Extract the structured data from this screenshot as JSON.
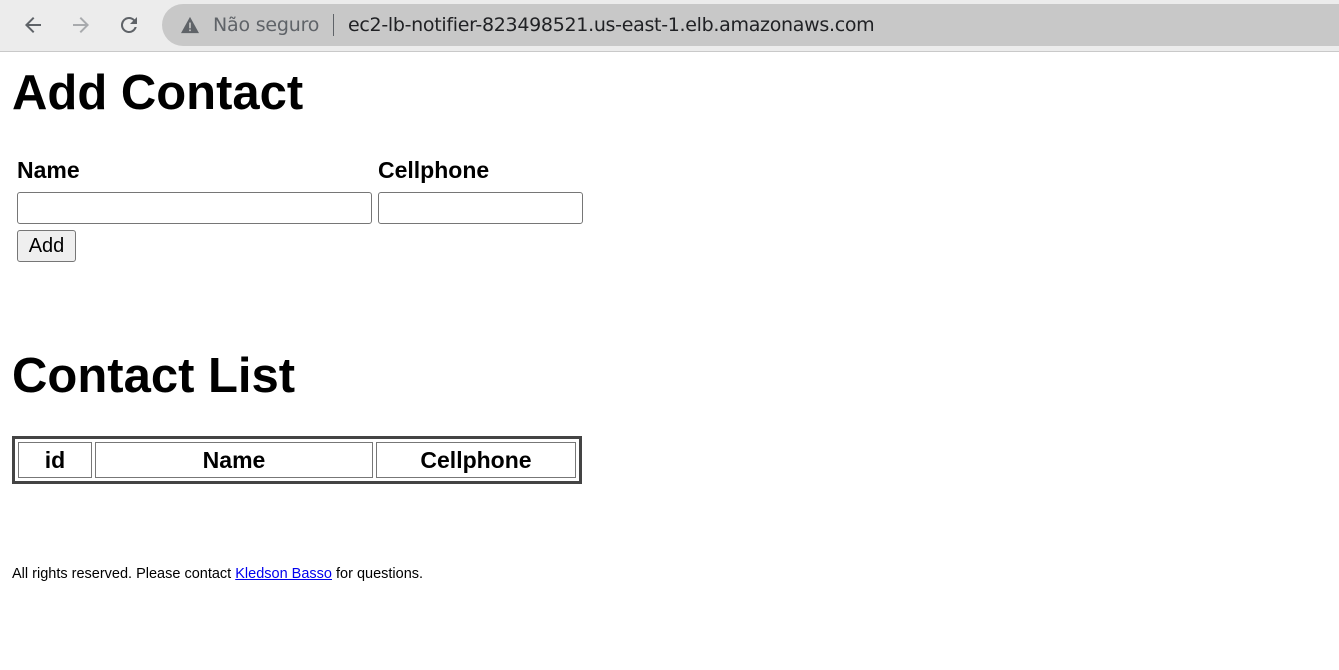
{
  "browser": {
    "security_label": "Não seguro",
    "url": "ec2-lb-notifier-823498521.us-east-1.elb.amazonaws.com"
  },
  "form": {
    "title": "Add Contact",
    "name_label": "Name",
    "name_value": "",
    "cellphone_label": "Cellphone",
    "cellphone_value": "",
    "add_button": "Add"
  },
  "list": {
    "title": "Contact List",
    "columns": [
      "id",
      "Name",
      "Cellphone"
    ],
    "rows": []
  },
  "footer": {
    "text_before": "All rights reserved. Please contact ",
    "link_text": "Kledson Basso",
    "text_after": " for questions."
  }
}
